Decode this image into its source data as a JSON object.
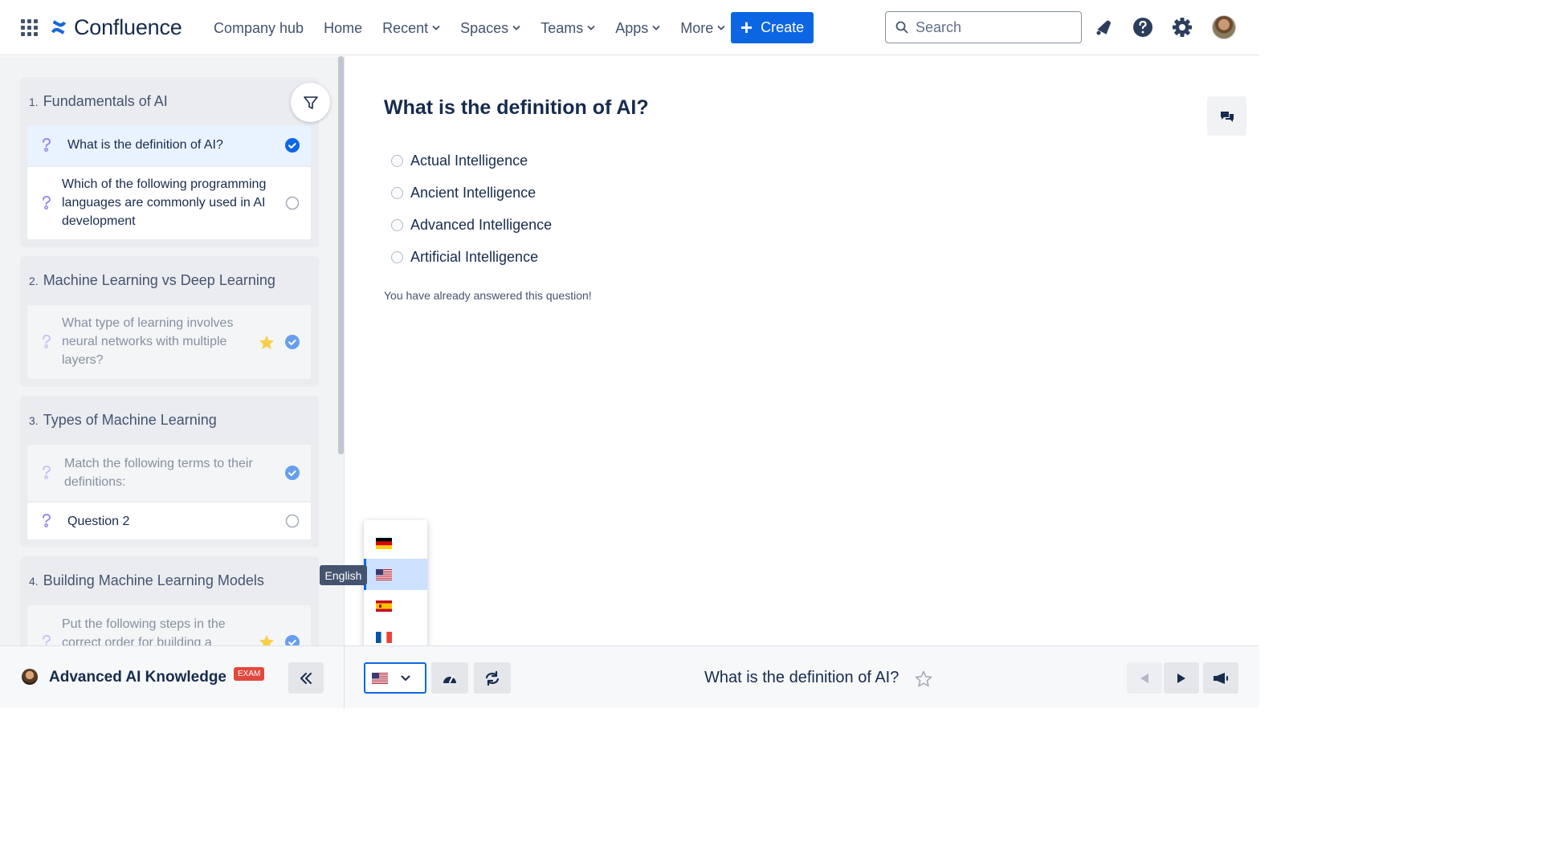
{
  "app": {
    "name": "Confluence",
    "brand_color": "#0c66e4"
  },
  "nav": {
    "items": [
      {
        "label": "Company hub",
        "dropdown": false
      },
      {
        "label": "Home",
        "dropdown": false
      },
      {
        "label": "Recent",
        "dropdown": true
      },
      {
        "label": "Spaces",
        "dropdown": true
      },
      {
        "label": "Teams",
        "dropdown": true
      },
      {
        "label": "Apps",
        "dropdown": true
      },
      {
        "label": "More",
        "dropdown": true
      }
    ],
    "create_label": "Create",
    "search_placeholder": "Search",
    "icons": [
      "notifications-icon",
      "help-icon",
      "settings-icon",
      "avatar"
    ]
  },
  "sidebar": {
    "sections": [
      {
        "number": "1.",
        "title": "Fundamentals of AI",
        "questions": [
          {
            "text": "What is the definition of AI?",
            "status": "answered",
            "active": true,
            "starred": false,
            "faded": false
          },
          {
            "text": "Which of the following programming languages are commonly used in AI development",
            "status": "unanswered",
            "active": false,
            "starred": false,
            "faded": false
          }
        ]
      },
      {
        "number": "2.",
        "title": "Machine Learning vs Deep Learning",
        "questions": [
          {
            "text": "What type of learning involves neural networks with multiple layers?",
            "status": "answered",
            "active": false,
            "starred": true,
            "faded": true
          }
        ]
      },
      {
        "number": "3.",
        "title": "Types of Machine Learning",
        "questions": [
          {
            "text": "Match the following terms to their definitions:",
            "status": "answered",
            "active": false,
            "starred": false,
            "faded": true
          },
          {
            "text": "Question 2",
            "status": "unanswered",
            "active": false,
            "starred": false,
            "faded": false
          }
        ]
      },
      {
        "number": "4.",
        "title": "Building Machine Learning Models",
        "questions": [
          {
            "text": "Put the following steps in the correct order for building a",
            "status": "answered",
            "active": false,
            "starred": true,
            "faded": true
          }
        ]
      }
    ]
  },
  "main": {
    "question_title": "What is the definition of AI?",
    "options": [
      "Actual Intelligence",
      "Ancient Intelligence",
      "Advanced Intelligence",
      "Artificial Intelligence"
    ],
    "answered_message": "You have already answered this question!"
  },
  "language_menu": {
    "options": [
      {
        "code": "de",
        "flag": "germany-flag"
      },
      {
        "code": "en-us",
        "flag": "us-flag",
        "selected": true
      },
      {
        "code": "es",
        "flag": "spain-flag"
      },
      {
        "code": "fr",
        "flag": "france-flag"
      }
    ],
    "tooltip": "English"
  },
  "bottombar": {
    "space_name": "Advanced AI Knowledge...",
    "badge": "EXAM",
    "current_question": "What is the definition of AI?"
  }
}
